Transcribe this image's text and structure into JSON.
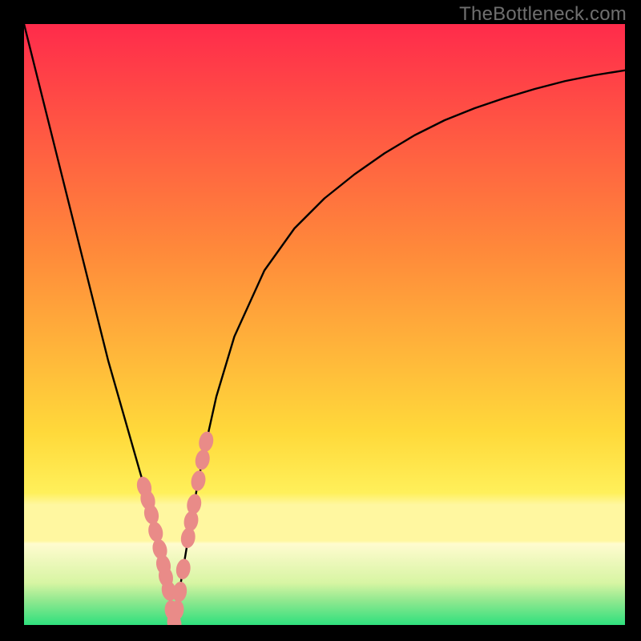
{
  "watermark": "TheBottleneck.com",
  "colors": {
    "black": "#000000",
    "curve": "#000000",
    "marker_fill": "#e98b88",
    "marker_stroke": "#e98b88",
    "grad_top": "#ff2b4b",
    "grad_mid1": "#ff8a3a",
    "grad_mid2": "#ffd93a",
    "grad_band": "#fff7a0",
    "grad_green1": "#b6ef7e",
    "grad_green2": "#2fe07d"
  },
  "chart_data": {
    "type": "line",
    "title": "",
    "xlabel": "",
    "ylabel": "",
    "xlim": [
      0,
      100
    ],
    "ylim": [
      0,
      100
    ],
    "series": [
      {
        "name": "bottleneck-curve",
        "x": [
          0,
          2,
          4,
          6,
          8,
          10,
          12,
          14,
          16,
          18,
          20,
          21,
          22,
          23,
          23.5,
          24,
          24.5,
          25,
          25.5,
          26,
          27,
          28,
          29,
          30,
          32,
          35,
          40,
          45,
          50,
          55,
          60,
          65,
          70,
          75,
          80,
          85,
          90,
          95,
          100
        ],
        "y": [
          100,
          92,
          84,
          76,
          68,
          60,
          52,
          44,
          37,
          30,
          23,
          19.5,
          16,
          12,
          9.5,
          6.5,
          3,
          0.3,
          3,
          6.5,
          12.5,
          18.5,
          24,
          29,
          38,
          48,
          59,
          66,
          71,
          75,
          78.5,
          81.5,
          84,
          86,
          87.7,
          89.2,
          90.5,
          91.5,
          92.3
        ]
      }
    ],
    "markers": {
      "name": "highlighted-points",
      "x": [
        20.0,
        20.6,
        21.2,
        21.9,
        22.6,
        23.2,
        23.6,
        24.1,
        24.6,
        25.0,
        25.4,
        25.9,
        26.5,
        27.3,
        27.8,
        28.3,
        29.0,
        29.7,
        30.3
      ],
      "y": [
        23.0,
        20.8,
        18.4,
        15.5,
        12.6,
        10.0,
        8.0,
        5.7,
        2.4,
        0.3,
        2.4,
        5.5,
        9.3,
        14.5,
        17.3,
        20.1,
        24.0,
        27.5,
        30.5
      ]
    }
  }
}
